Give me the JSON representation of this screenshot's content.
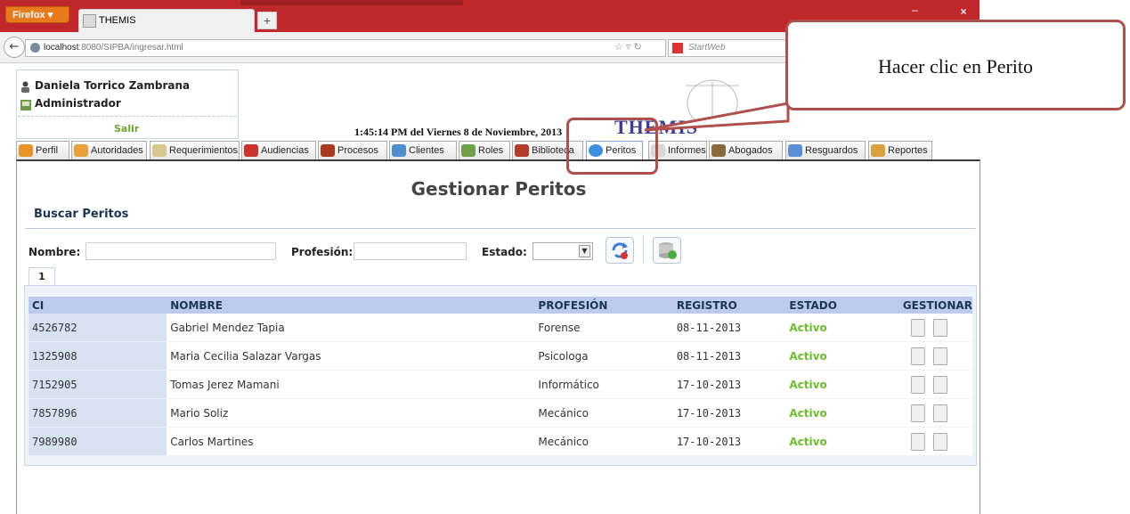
{
  "browser": {
    "menu_label": "Firefox",
    "tab_title": "THEMIS",
    "new_tab": "+",
    "url_host": "localhost",
    "url_path": ":8080/SIPBA/ingresar.html",
    "search_placeholder": "StartWeb",
    "win_min": "–",
    "win_close": "×"
  },
  "user": {
    "name": "Daniela Torrico Zambrana",
    "role": "Administrador",
    "logout": "Salir"
  },
  "datetime": "1:45:14 PM del Viernes 8 de Noviembre, 2013",
  "logo_text": "THEMIS",
  "tabs": [
    {
      "label": "Perfil",
      "color": "#e8922a"
    },
    {
      "label": "Autoridades",
      "color": "#e9a23b"
    },
    {
      "label": "Requerimientos",
      "color": "#d9c78f"
    },
    {
      "label": "Audiencias",
      "color": "#c9322d"
    },
    {
      "label": "Procesos",
      "color": "#a83a1f"
    },
    {
      "label": "Clientes",
      "color": "#4f8fd0"
    },
    {
      "label": "Roles",
      "color": "#6fa04a"
    },
    {
      "label": "Biblioteca",
      "color": "#b43c2b"
    },
    {
      "label": "Peritos",
      "color": "#3f8fe0"
    },
    {
      "label": "Informes",
      "color": "#d7d7d7"
    },
    {
      "label": "Abogados",
      "color": "#8a6a3b"
    },
    {
      "label": "Resguardos",
      "color": "#5c8ed6"
    },
    {
      "label": "Reportes",
      "color": "#d9a23a"
    }
  ],
  "page": {
    "title": "Gestionar Peritos",
    "section": "Buscar Peritos",
    "filters": {
      "nombre_label": "Nombre:",
      "profesion_label": "Profesión:",
      "estado_label": "Estado:"
    },
    "page_number": "1"
  },
  "table": {
    "columns": [
      "CI",
      "NOMBRE",
      "PROFESIÓN",
      "REGISTRO",
      "ESTADO",
      "GESTIONAR"
    ],
    "rows": [
      {
        "ci": "4526782",
        "nombre": "Gabriel Mendez Tapia",
        "profesion": "Forense",
        "registro": "08-11-2013",
        "estado": "Activo"
      },
      {
        "ci": "1325908",
        "nombre": "Maria Cecilia Salazar Vargas",
        "profesion": "Psicologa",
        "registro": "08-11-2013",
        "estado": "Activo"
      },
      {
        "ci": "7152905",
        "nombre": "Tomas Jerez Mamani",
        "profesion": "Informático",
        "registro": "17-10-2013",
        "estado": "Activo"
      },
      {
        "ci": "7857896",
        "nombre": "Mario Soliz",
        "profesion": "Mecánico",
        "registro": "17-10-2013",
        "estado": "Activo"
      },
      {
        "ci": "7989980",
        "nombre": "Carlos Martines",
        "profesion": "Mecánico",
        "registro": "17-10-2013",
        "estado": "Activo"
      }
    ]
  },
  "callout": "Hacer clic en Perito",
  "colors": {
    "accent": "#c0282b",
    "status_active": "#6abf2b",
    "header_bg": "#bccbec",
    "callout_border": "#b0504d"
  }
}
